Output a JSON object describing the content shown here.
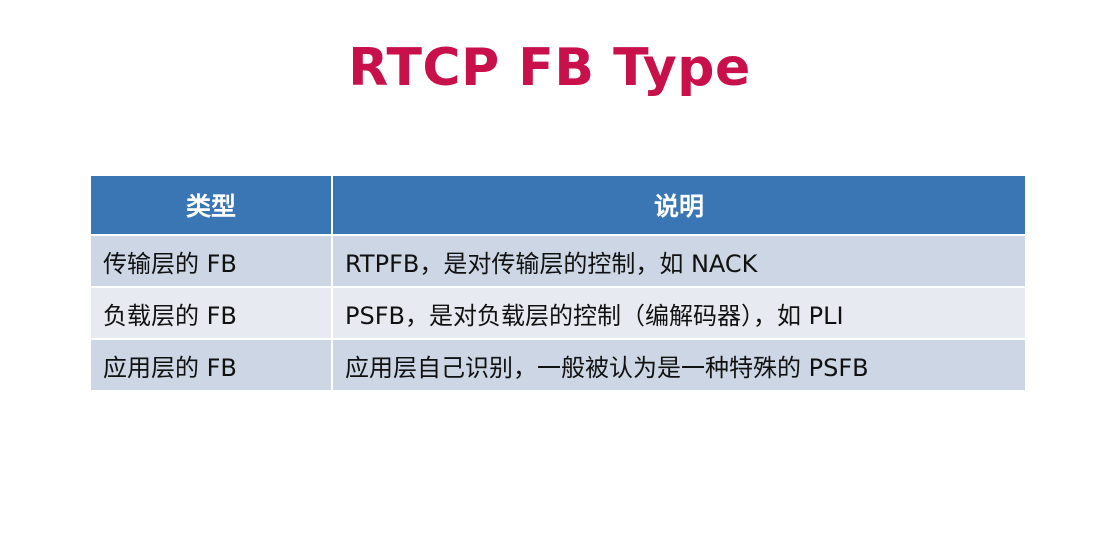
{
  "slide": {
    "title": "RTCP FB Type"
  },
  "table": {
    "headers": [
      "类型",
      "说明"
    ],
    "rows": [
      {
        "type": "传输层的 FB",
        "desc": "RTPFB，是对传输层的控制，如 NACK"
      },
      {
        "type": "负载层的 FB",
        "desc": "PSFB，是对负载层的控制（编解码器），如 PLI"
      },
      {
        "type": "应用层的 FB",
        "desc": "应用层自己识别，一般被认为是一种特殊的 PSFB"
      }
    ]
  },
  "colors": {
    "title": "#C8114A",
    "header_bg": "#3A76B4",
    "row_bg_dark": "#CDD6E4",
    "row_bg_light": "#E7EBF1"
  }
}
